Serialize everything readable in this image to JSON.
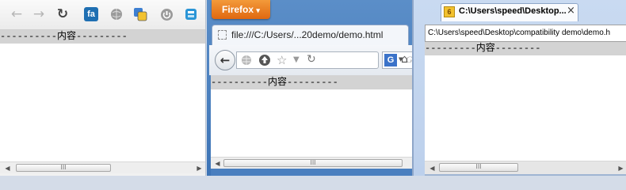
{
  "chrome": {
    "content_text": "----------内容---------",
    "scroll_thumb": "III",
    "icons": [
      "back-arrow-icon",
      "forward-arrow-icon",
      "reload-icon",
      "fontawesome-extension-icon",
      "globe-extension-icon",
      "translate-extension-icon",
      "power-extension-icon",
      "calculator-extension-icon"
    ],
    "ext_fa_label": "fa"
  },
  "firefox": {
    "menu_button": "Firefox",
    "menu_arrow": "▾",
    "tab_title": "file:///C:/Users/...20demo/demo.html",
    "content_text": "----------内容---------",
    "scroll_thumb": "III",
    "search_letter": "G",
    "search_hint": "G"
  },
  "ie": {
    "tab_title": "C:\\Users\\speed\\Desktop...",
    "tab_close": "×",
    "tab_badge": "6",
    "address": "C:\\Users\\speed\\Desktop\\compatibility demo\\demo.h",
    "content_text": "---------内容--------",
    "scroll_thumb": "III"
  },
  "colors": {
    "firefox_orange": "#e86f17",
    "ie_frame": "#bcd0ec",
    "content_gray": "#d3d3d3"
  }
}
